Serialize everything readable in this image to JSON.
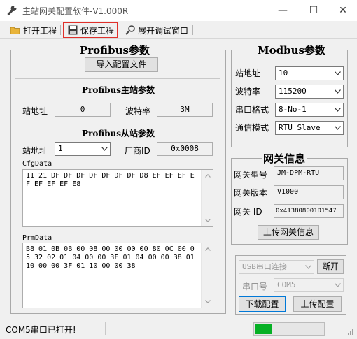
{
  "window": {
    "title": "主站网关配置软件-V1.000R",
    "minimize": "—",
    "maximize": "☐",
    "close": "✕"
  },
  "toolbar": {
    "open": "打开工程",
    "save": "保存工程",
    "debug": "展开调试窗口"
  },
  "profibus": {
    "title": "Profibus参数",
    "import_button": "导入配置文件",
    "master": {
      "title": "Profibus主站参数",
      "address_label": "站地址",
      "address_value": "0",
      "baud_label": "波特率",
      "baud_value": "3M"
    },
    "slave": {
      "title": "Profibus从站参数",
      "address_label": "站地址",
      "address_value": "1",
      "vendor_label": "厂商ID",
      "vendor_value": "0x0008"
    },
    "cfgdata": {
      "label": "CfgData",
      "text": "11 21 DF DF DF DF DF DF DF D8 EF EF EF EF EF EF EF E8"
    },
    "prmdata": {
      "label": "PrmData",
      "text": "B8 01 0B 0B 00 08 00 00 00 00 80 0C 00 05 32 02 01 04 00 00 3F 01 04 00 00 38 01 10 00 00 3F 01 10 00 00 38"
    }
  },
  "modbus": {
    "title": "Modbus参数",
    "address_label": "站地址",
    "address_value": "10",
    "baud_label": "波特率",
    "baud_value": "115200",
    "format_label": "串口格式",
    "format_value": "8-No-1",
    "mode_label": "通信模式",
    "mode_value": "RTU Slave"
  },
  "gateway": {
    "title": "网关信息",
    "model_label": "网关型号",
    "model_value": "JM-DPM-RTU",
    "version_label": "网关版本",
    "version_value": "V1000",
    "id_label": "网关 ID",
    "id_value": "0x413808001D1547",
    "upload_info_button": "上传网关信息"
  },
  "connection": {
    "type_value": "USB串口连接",
    "disconnect_button": "断开",
    "port_label": "串口号",
    "port_value": "COM5",
    "download_button": "下载配置",
    "upload_button": "上传配置"
  },
  "status": {
    "text": "COM5串口已打开!",
    "progress": 0.25,
    "progress_color": "#06b025"
  },
  "colors": {
    "highlight": "#e0302a"
  }
}
